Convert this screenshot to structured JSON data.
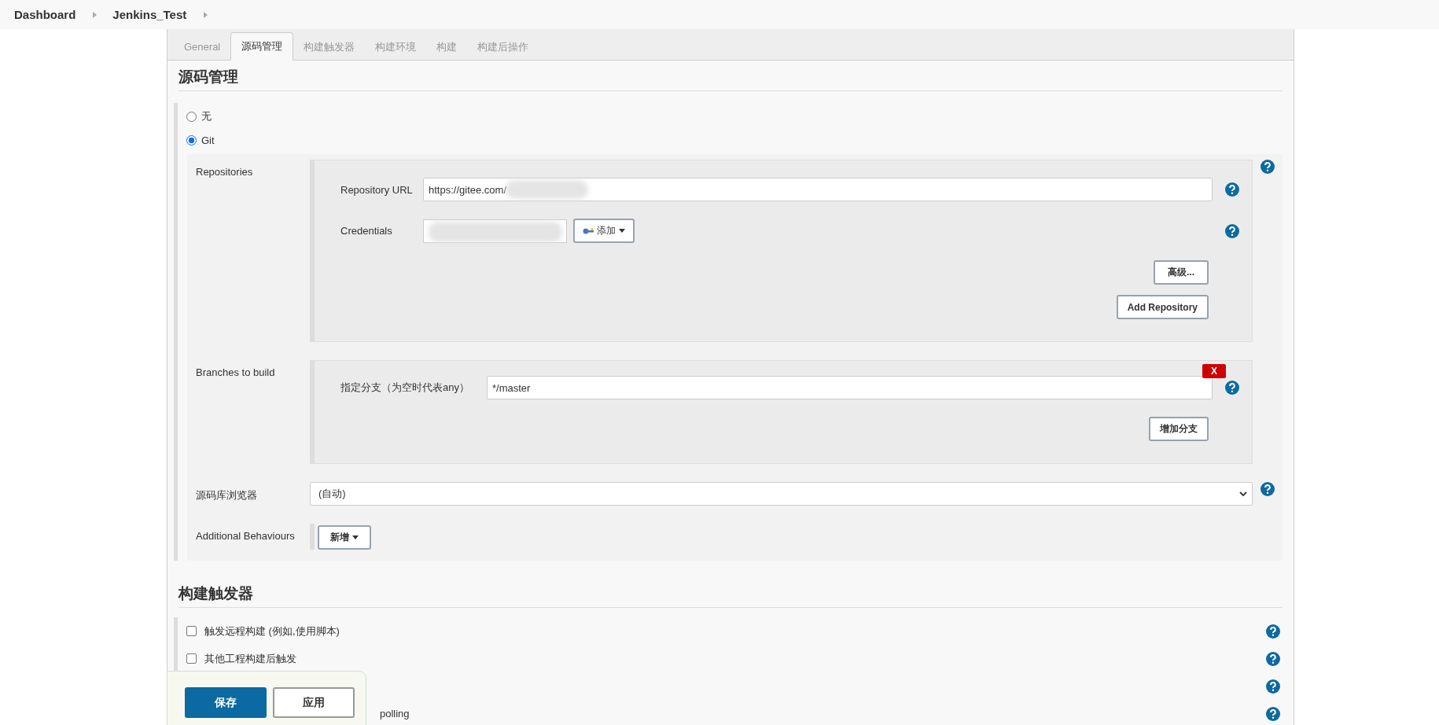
{
  "breadcrumbs": [
    {
      "label": "Dashboard"
    },
    {
      "label": "Jenkins_Test"
    }
  ],
  "tabs": [
    {
      "label": "General",
      "selected": false
    },
    {
      "label": "源码管理",
      "selected": true
    },
    {
      "label": "构建触发器",
      "selected": false
    },
    {
      "label": "构建环境",
      "selected": false
    },
    {
      "label": "构建",
      "selected": false
    },
    {
      "label": "构建后操作",
      "selected": false
    }
  ],
  "scm": {
    "title": "源码管理",
    "options": [
      {
        "label": "无",
        "selected": false
      },
      {
        "label": "Git",
        "selected": true
      }
    ],
    "git": {
      "repositories": {
        "label": "Repositories",
        "url_label": "Repository URL",
        "url_value": "https://gitee.com/",
        "credentials_label": "Credentials",
        "add_button": "添加",
        "advanced_button": "高级...",
        "add_repository_button": "Add Repository"
      },
      "branches": {
        "label": "Branches to build",
        "branch_label": "指定分支（为空时代表any）",
        "branch_value": "*/master",
        "delete_button": "X",
        "add_branch_button": "增加分支"
      },
      "browser": {
        "label": "源码库浏览器",
        "value": "(自动)"
      },
      "behaviours": {
        "label": "Additional Behaviours",
        "add_button": "新增"
      }
    }
  },
  "triggers": {
    "title": "构建触发器",
    "items": [
      {
        "label": "触发远程构建 (例如,使用脚本)",
        "checked": false,
        "kind": "full"
      },
      {
        "label": "其他工程构建后触发",
        "checked": false,
        "kind": "full"
      },
      {
        "kind": "covered"
      },
      {
        "label": "polling",
        "kind": "partial"
      }
    ]
  },
  "footer": {
    "buttons": [
      {
        "label": "保存",
        "kind": "primary"
      },
      {
        "label": "应用",
        "kind": "secondary"
      }
    ]
  }
}
